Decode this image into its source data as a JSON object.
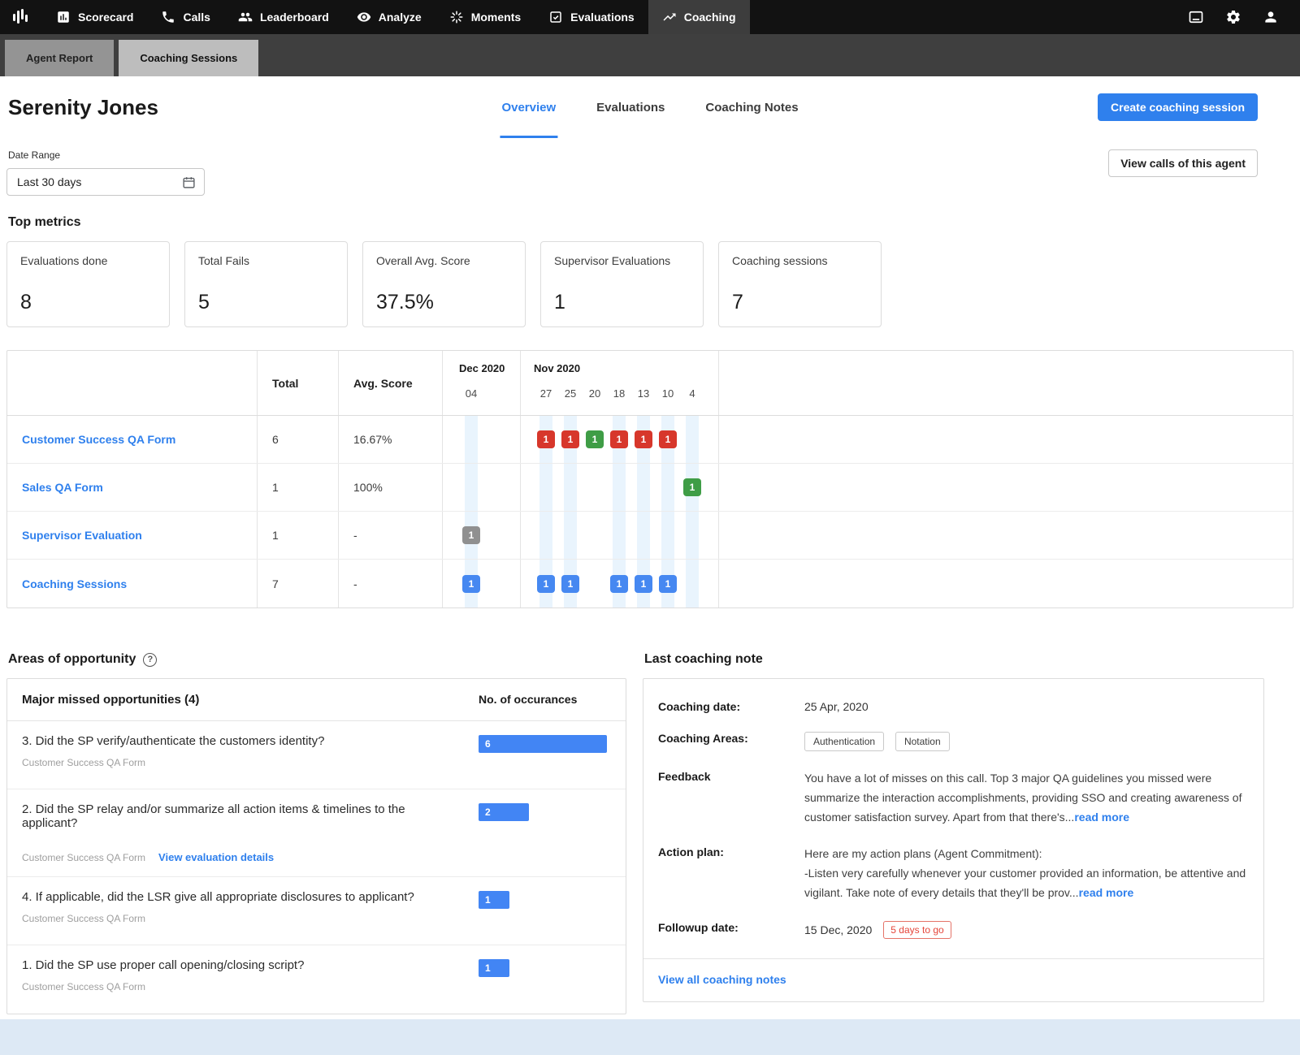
{
  "colors": {
    "accent_blue": "#2f80ed",
    "badge_red": "#d7372b",
    "badge_green": "#3f9d46",
    "badge_gray": "#909090",
    "badge_blue": "#4688f1",
    "bar_blue": "#4285f4"
  },
  "nav": {
    "items": [
      {
        "label": "Scorecard",
        "icon": "scorecard-icon"
      },
      {
        "label": "Calls",
        "icon": "phone-icon"
      },
      {
        "label": "Leaderboard",
        "icon": "people-icon"
      },
      {
        "label": "Analyze",
        "icon": "eye-icon"
      },
      {
        "label": "Moments",
        "icon": "spark-icon"
      },
      {
        "label": "Evaluations",
        "icon": "checkbox-icon"
      },
      {
        "label": "Coaching",
        "icon": "trend-up-icon",
        "active": true
      }
    ]
  },
  "subtabs": [
    {
      "label": "Agent Report"
    },
    {
      "label": "Coaching Sessions",
      "active": true
    }
  ],
  "header": {
    "title": "Serenity Jones",
    "tabs": [
      {
        "label": "Overview",
        "active": true
      },
      {
        "label": "Evaluations"
      },
      {
        "label": "Coaching Notes"
      }
    ],
    "create_button": "Create coaching session"
  },
  "filters": {
    "date_range_label": "Date Range",
    "date_range_value": "Last 30 days",
    "view_calls_button": "View calls of this agent"
  },
  "top_metrics": {
    "heading": "Top metrics",
    "cards": [
      {
        "label": "Evaluations done",
        "value": "8"
      },
      {
        "label": "Total Fails",
        "value": "5"
      },
      {
        "label": "Overall Avg. Score",
        "value": "37.5%"
      },
      {
        "label": "Supervisor Evaluations",
        "value": "1"
      },
      {
        "label": "Coaching sessions",
        "value": "7"
      }
    ]
  },
  "timeline_table": {
    "columns": {
      "total": "Total",
      "avg_score": "Avg. Score"
    },
    "month_groups": [
      {
        "label": "Dec 2020",
        "days": [
          "04"
        ]
      },
      {
        "label": "Nov 2020",
        "days": [
          "27",
          "25",
          "20",
          "18",
          "13",
          "10",
          "4"
        ]
      }
    ],
    "highlighted_day_indexes": [
      0,
      1,
      2,
      4,
      5,
      6,
      7
    ],
    "rows": [
      {
        "name": "Customer Success QA Form",
        "total": "6",
        "avg": "16.67%",
        "badges": {
          "1": {
            "v": "1",
            "bg": "#d7372b"
          },
          "2": {
            "v": "1",
            "bg": "#d7372b"
          },
          "3": {
            "v": "1",
            "bg": "#3f9d46"
          },
          "4": {
            "v": "1",
            "bg": "#d7372b"
          },
          "5": {
            "v": "1",
            "bg": "#d7372b"
          },
          "6": {
            "v": "1",
            "bg": "#d7372b"
          }
        }
      },
      {
        "name": "Sales QA Form",
        "total": "1",
        "avg": "100%",
        "badges": {
          "7": {
            "v": "1",
            "bg": "#3f9d46"
          }
        }
      },
      {
        "name": "Supervisor Evaluation",
        "total": "1",
        "avg": "-",
        "badges": {
          "0": {
            "v": "1",
            "bg": "#909090"
          }
        }
      },
      {
        "name": "Coaching Sessions",
        "total": "7",
        "avg": "-",
        "badges": {
          "0": {
            "v": "1",
            "bg": "#4688f1"
          },
          "1": {
            "v": "1",
            "bg": "#4688f1"
          },
          "2": {
            "v": "1",
            "bg": "#4688f1"
          },
          "4": {
            "v": "1",
            "bg": "#4688f1"
          },
          "5": {
            "v": "1",
            "bg": "#4688f1"
          },
          "6": {
            "v": "1",
            "bg": "#4688f1"
          }
        }
      }
    ]
  },
  "areas": {
    "heading": "Areas of opportunity",
    "help_glyph": "?",
    "card_header": {
      "left": "Major missed opportunities (4)",
      "right": "No. of occurances"
    },
    "items": [
      {
        "question": "3. Did the SP verify/authenticate the customers identity?",
        "form": "Customer Success QA Form",
        "count": "6"
      },
      {
        "question": "2. Did the SP relay and/or summarize all action items & timelines to the applicant?",
        "form": "Customer Success QA Form",
        "link": "View evaluation details",
        "count": "2"
      },
      {
        "question": "4. If applicable, did the LSR give all appropriate disclosures to applicant?",
        "form": "Customer Success QA Form",
        "count": "1"
      },
      {
        "question": "1. Did the SP use proper call opening/closing script?",
        "form": "Customer Success QA Form",
        "count": "1"
      }
    ]
  },
  "coaching_note": {
    "heading": "Last coaching note",
    "date_label": "Coaching date:",
    "date_value": "25 Apr, 2020",
    "areas_label": "Coaching Areas:",
    "areas_chips": [
      "Authentication",
      "Notation"
    ],
    "feedback_label": "Feedback",
    "feedback_text": "You have a lot of misses on this call. Top 3 major QA guidelines you missed were summarize the interaction accomplishments, providing SSO and creating awareness of customer satisfaction survey. Apart from that there's...",
    "read_more": "read more",
    "action_label": "Action plan:",
    "action_text": "Here are my action plans (Agent Commitment):\n-Listen very carefully whenever your customer provided an information, be attentive and vigilant. Take note of every details that they'll be prov...",
    "followup_label": "Followup date:",
    "followup_value": "15 Dec, 2020",
    "followup_badge": "5 days to go",
    "footer_link": "View all coaching notes"
  }
}
